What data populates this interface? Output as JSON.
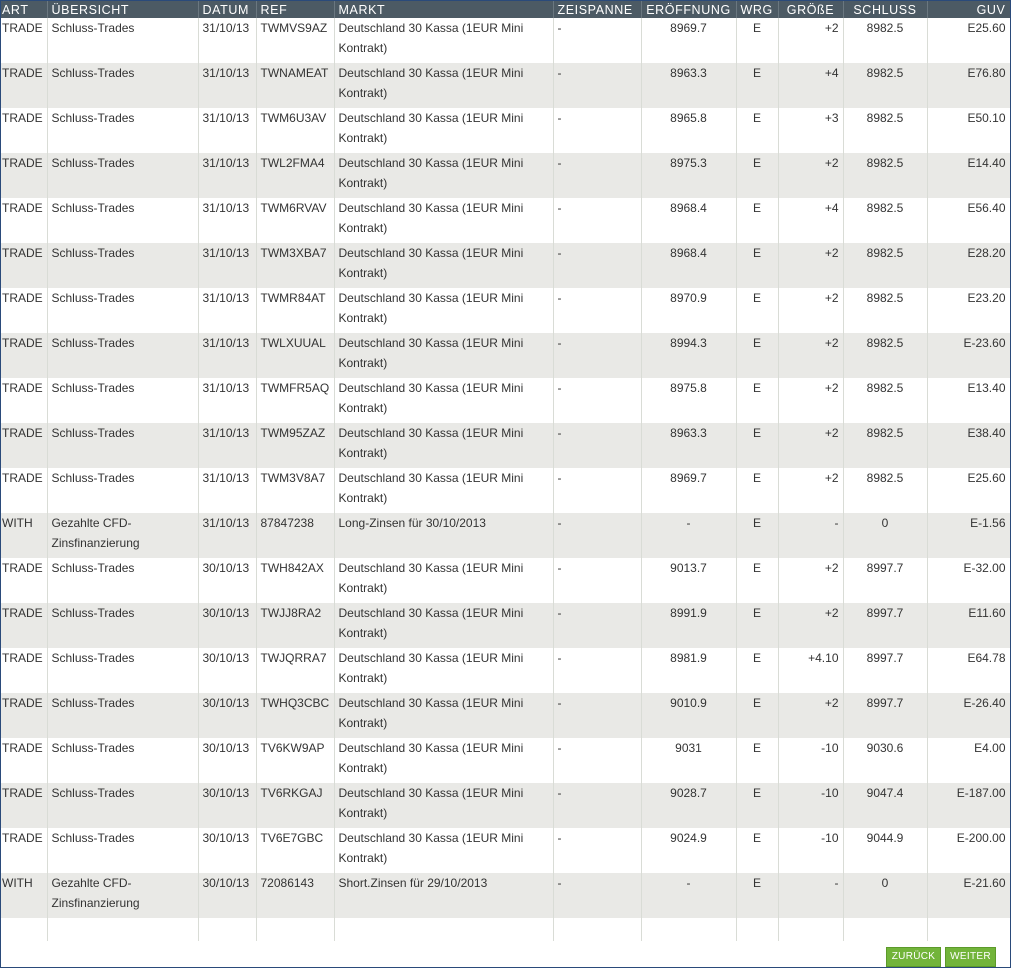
{
  "columns": [
    "ART",
    "ÜBERSICHT",
    "DATUM",
    "REF",
    "MARKT",
    "ZEISPANNE",
    "ERÖFFNUNG",
    "WRG",
    "GRÖßE",
    "SCHLUSS",
    "GUV"
  ],
  "rows": [
    {
      "art": "TRADE",
      "uebersicht": "Schluss-Trades",
      "datum": "31/10/13",
      "ref": "TWMVS9AZ",
      "markt": "Deutschland 30 Kassa (1EUR Mini Kontrakt)",
      "zeitspanne": "-",
      "eroeffnung": "8969.7",
      "wrg": "E",
      "groesse": "+2",
      "schluss": "8982.5",
      "guv": "E25.60"
    },
    {
      "art": "TRADE",
      "uebersicht": "Schluss-Trades",
      "datum": "31/10/13",
      "ref": "TWNAMEAT",
      "markt": "Deutschland 30 Kassa (1EUR Mini Kontrakt)",
      "zeitspanne": "-",
      "eroeffnung": "8963.3",
      "wrg": "E",
      "groesse": "+4",
      "schluss": "8982.5",
      "guv": "E76.80"
    },
    {
      "art": "TRADE",
      "uebersicht": "Schluss-Trades",
      "datum": "31/10/13",
      "ref": "TWM6U3AV",
      "markt": "Deutschland 30 Kassa (1EUR Mini Kontrakt)",
      "zeitspanne": "-",
      "eroeffnung": "8965.8",
      "wrg": "E",
      "groesse": "+3",
      "schluss": "8982.5",
      "guv": "E50.10"
    },
    {
      "art": "TRADE",
      "uebersicht": "Schluss-Trades",
      "datum": "31/10/13",
      "ref": "TWL2FMA4",
      "markt": "Deutschland 30 Kassa (1EUR Mini Kontrakt)",
      "zeitspanne": "-",
      "eroeffnung": "8975.3",
      "wrg": "E",
      "groesse": "+2",
      "schluss": "8982.5",
      "guv": "E14.40"
    },
    {
      "art": "TRADE",
      "uebersicht": "Schluss-Trades",
      "datum": "31/10/13",
      "ref": "TWM6RVAV",
      "markt": "Deutschland 30 Kassa (1EUR Mini Kontrakt)",
      "zeitspanne": "-",
      "eroeffnung": "8968.4",
      "wrg": "E",
      "groesse": "+4",
      "schluss": "8982.5",
      "guv": "E56.40"
    },
    {
      "art": "TRADE",
      "uebersicht": "Schluss-Trades",
      "datum": "31/10/13",
      "ref": "TWM3XBA7",
      "markt": "Deutschland 30 Kassa (1EUR Mini Kontrakt)",
      "zeitspanne": "-",
      "eroeffnung": "8968.4",
      "wrg": "E",
      "groesse": "+2",
      "schluss": "8982.5",
      "guv": "E28.20"
    },
    {
      "art": "TRADE",
      "uebersicht": "Schluss-Trades",
      "datum": "31/10/13",
      "ref": "TWMR84AT",
      "markt": "Deutschland 30 Kassa (1EUR Mini Kontrakt)",
      "zeitspanne": "-",
      "eroeffnung": "8970.9",
      "wrg": "E",
      "groesse": "+2",
      "schluss": "8982.5",
      "guv": "E23.20"
    },
    {
      "art": "TRADE",
      "uebersicht": "Schluss-Trades",
      "datum": "31/10/13",
      "ref": "TWLXUUAL",
      "markt": "Deutschland 30 Kassa (1EUR Mini Kontrakt)",
      "zeitspanne": "-",
      "eroeffnung": "8994.3",
      "wrg": "E",
      "groesse": "+2",
      "schluss": "8982.5",
      "guv": "E-23.60"
    },
    {
      "art": "TRADE",
      "uebersicht": "Schluss-Trades",
      "datum": "31/10/13",
      "ref": "TWMFR5AQ",
      "markt": "Deutschland 30 Kassa (1EUR Mini Kontrakt)",
      "zeitspanne": "-",
      "eroeffnung": "8975.8",
      "wrg": "E",
      "groesse": "+2",
      "schluss": "8982.5",
      "guv": "E13.40"
    },
    {
      "art": "TRADE",
      "uebersicht": "Schluss-Trades",
      "datum": "31/10/13",
      "ref": "TWM95ZAZ",
      "markt": "Deutschland 30 Kassa (1EUR Mini Kontrakt)",
      "zeitspanne": "-",
      "eroeffnung": "8963.3",
      "wrg": "E",
      "groesse": "+2",
      "schluss": "8982.5",
      "guv": "E38.40"
    },
    {
      "art": "TRADE",
      "uebersicht": "Schluss-Trades",
      "datum": "31/10/13",
      "ref": "TWM3V8A7",
      "markt": "Deutschland 30 Kassa (1EUR Mini Kontrakt)",
      "zeitspanne": "-",
      "eroeffnung": "8969.7",
      "wrg": "E",
      "groesse": "+2",
      "schluss": "8982.5",
      "guv": "E25.60"
    },
    {
      "art": "WITH",
      "uebersicht": "Gezahlte CFD-Zinsfinanzierung",
      "datum": "31/10/13",
      "ref": "87847238",
      "markt": "Long-Zinsen für 30/10/2013",
      "zeitspanne": "-",
      "eroeffnung": "-",
      "wrg": "E",
      "groesse": "-",
      "schluss": "0",
      "guv": "E-1.56"
    },
    {
      "art": "TRADE",
      "uebersicht": "Schluss-Trades",
      "datum": "30/10/13",
      "ref": "TWH842AX",
      "markt": "Deutschland 30 Kassa (1EUR Mini Kontrakt)",
      "zeitspanne": "-",
      "eroeffnung": "9013.7",
      "wrg": "E",
      "groesse": "+2",
      "schluss": "8997.7",
      "guv": "E-32.00"
    },
    {
      "art": "TRADE",
      "uebersicht": "Schluss-Trades",
      "datum": "30/10/13",
      "ref": "TWJJ8RA2",
      "markt": "Deutschland 30 Kassa (1EUR Mini Kontrakt)",
      "zeitspanne": "-",
      "eroeffnung": "8991.9",
      "wrg": "E",
      "groesse": "+2",
      "schluss": "8997.7",
      "guv": "E11.60"
    },
    {
      "art": "TRADE",
      "uebersicht": "Schluss-Trades",
      "datum": "30/10/13",
      "ref": "TWJQRRA7",
      "markt": "Deutschland 30 Kassa (1EUR Mini Kontrakt)",
      "zeitspanne": "-",
      "eroeffnung": "8981.9",
      "wrg": "E",
      "groesse": "+4.10",
      "schluss": "8997.7",
      "guv": "E64.78"
    },
    {
      "art": "TRADE",
      "uebersicht": "Schluss-Trades",
      "datum": "30/10/13",
      "ref": "TWHQ3CBC",
      "markt": "Deutschland 30 Kassa (1EUR Mini Kontrakt)",
      "zeitspanne": "-",
      "eroeffnung": "9010.9",
      "wrg": "E",
      "groesse": "+2",
      "schluss": "8997.7",
      "guv": "E-26.40"
    },
    {
      "art": "TRADE",
      "uebersicht": "Schluss-Trades",
      "datum": "30/10/13",
      "ref": "TV6KW9AP",
      "markt": "Deutschland 30 Kassa (1EUR Mini Kontrakt)",
      "zeitspanne": "-",
      "eroeffnung": "9031",
      "wrg": "E",
      "groesse": "-10",
      "schluss": "9030.6",
      "guv": "E4.00"
    },
    {
      "art": "TRADE",
      "uebersicht": "Schluss-Trades",
      "datum": "30/10/13",
      "ref": "TV6RKGAJ",
      "markt": "Deutschland 30 Kassa (1EUR Mini Kontrakt)",
      "zeitspanne": "-",
      "eroeffnung": "9028.7",
      "wrg": "E",
      "groesse": "-10",
      "schluss": "9047.4",
      "guv": "E-187.00"
    },
    {
      "art": "TRADE",
      "uebersicht": "Schluss-Trades",
      "datum": "30/10/13",
      "ref": "TV6E7GBC",
      "markt": "Deutschland 30 Kassa (1EUR Mini Kontrakt)",
      "zeitspanne": "-",
      "eroeffnung": "9024.9",
      "wrg": "E",
      "groesse": "-10",
      "schluss": "9044.9",
      "guv": "E-200.00"
    },
    {
      "art": "WITH",
      "uebersicht": "Gezahlte CFD-Zinsfinanzierung",
      "datum": "30/10/13",
      "ref": "72086143",
      "markt": "Short.Zinsen für 29/10/2013",
      "zeitspanne": "-",
      "eroeffnung": "-",
      "wrg": "E",
      "groesse": "-",
      "schluss": "0",
      "guv": "E-21.60"
    }
  ],
  "pagination": {
    "back_label": "ZURÜCK",
    "next_label": "WEITER"
  },
  "colors": {
    "header_bg": "#4c5a64",
    "row_alt": "#e9e9e6",
    "button_bg": "#72b43a"
  }
}
